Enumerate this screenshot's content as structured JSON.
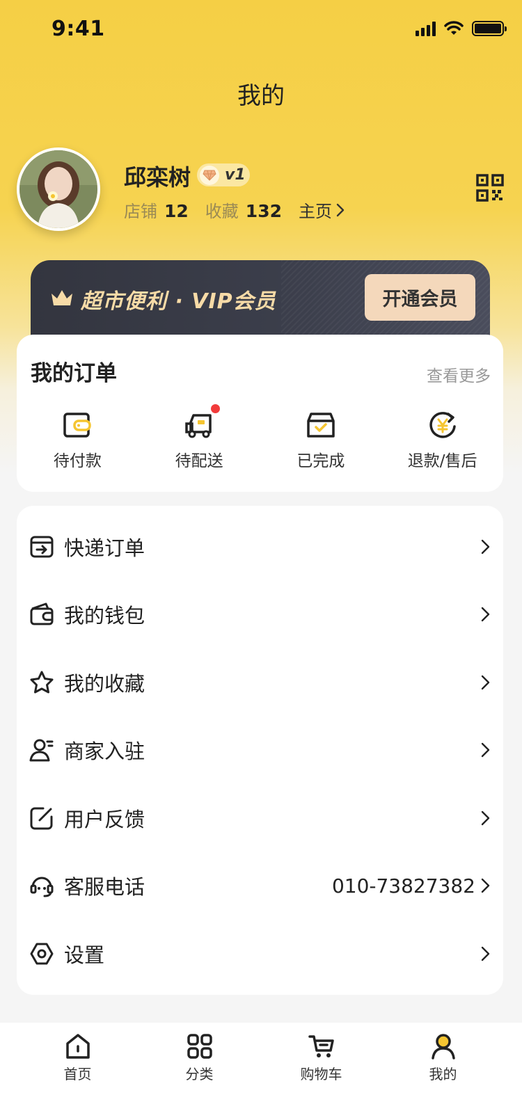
{
  "status_bar": {
    "time": "9:41"
  },
  "header": {
    "title": "我的"
  },
  "profile": {
    "name": "邱栾树",
    "level": "v1",
    "stats": [
      {
        "label": "店铺",
        "value": "12"
      },
      {
        "label": "收藏",
        "value": "132"
      }
    ],
    "home_link": "主页"
  },
  "vip": {
    "text": "超市便利 · VIP会员",
    "button_label": "开通会员"
  },
  "orders": {
    "title": "我的订单",
    "more_label": "查看更多",
    "items": [
      {
        "label": "待付款",
        "icon": "wallet-icon"
      },
      {
        "label": "待配送",
        "icon": "delivery-truck-icon",
        "badge": true
      },
      {
        "label": "已完成",
        "icon": "box-check-icon"
      },
      {
        "label": "退款/售后",
        "icon": "refund-yen-icon"
      }
    ]
  },
  "menu": {
    "items": [
      {
        "label": "快递订单",
        "icon": "express-box-icon"
      },
      {
        "label": "我的钱包",
        "icon": "wallet-icon"
      },
      {
        "label": "我的收藏",
        "icon": "star-icon"
      },
      {
        "label": "商家入驻",
        "icon": "user-join-icon"
      },
      {
        "label": "用户反馈",
        "icon": "edit-icon"
      },
      {
        "label": "客服电话",
        "icon": "headset-icon",
        "value": "010-73827382"
      },
      {
        "label": "设置",
        "icon": "settings-icon"
      }
    ]
  },
  "tab_bar": {
    "items": [
      {
        "label": "首页",
        "icon": "home-icon"
      },
      {
        "label": "分类",
        "icon": "grid-icon"
      },
      {
        "label": "购物车",
        "icon": "cart-icon"
      },
      {
        "label": "我的",
        "icon": "user-icon",
        "active": true
      }
    ]
  },
  "colors": {
    "accent": "#F5CF45",
    "vip_gold": "#F7DBA7",
    "vip_dark": "#33353F",
    "badge_red": "#F23B3B"
  }
}
